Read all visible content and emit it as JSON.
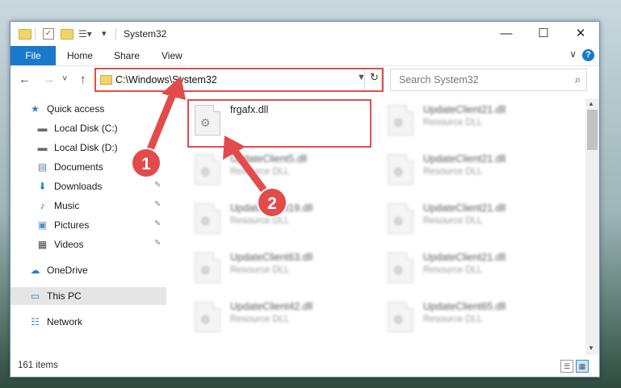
{
  "window": {
    "title": "System32",
    "controls": {
      "minimize": "—",
      "maximize": "☐",
      "close": "✕"
    }
  },
  "ribbon": {
    "tabs": [
      "File",
      "Home",
      "Share",
      "View"
    ],
    "help": "?",
    "expand": "∨"
  },
  "nav": {
    "back": "←",
    "forward": "→",
    "recent": "˅",
    "up": "↑",
    "address": "C:\\Windows\\System32",
    "search_placeholder": "Search System32"
  },
  "sidebar": {
    "items": [
      {
        "label": "Quick access",
        "icon": "star-icon",
        "glyph": "★",
        "color": "#2c7fd1"
      },
      {
        "label": "Local Disk (C:)",
        "icon": "drive-icon",
        "glyph": "▬",
        "color": "#6a6a6a"
      },
      {
        "label": "Local Disk (D:)",
        "icon": "drive-icon",
        "glyph": "▬",
        "color": "#6a6a6a"
      },
      {
        "label": "Documents",
        "icon": "document-icon",
        "glyph": "▤",
        "color": "#5b7fa8"
      },
      {
        "label": "Downloads",
        "icon": "download-icon",
        "glyph": "⬇",
        "color": "#2c7fd1"
      },
      {
        "label": "Music",
        "icon": "music-icon",
        "glyph": "♪",
        "color": "#2c7fd1"
      },
      {
        "label": "Pictures",
        "icon": "pictures-icon",
        "glyph": "▣",
        "color": "#4a90c9"
      },
      {
        "label": "Videos",
        "icon": "videos-icon",
        "glyph": "▦",
        "color": "#444"
      },
      {
        "label": "OneDrive",
        "icon": "cloud-icon",
        "glyph": "☁",
        "color": "#2c7fd1"
      },
      {
        "label": "This PC",
        "icon": "computer-icon",
        "glyph": "▭",
        "color": "#2c7fd1"
      },
      {
        "label": "Network",
        "icon": "network-icon",
        "glyph": "☷",
        "color": "#2c7fd1"
      }
    ],
    "pin": "📌"
  },
  "files": [
    {
      "name": "frgafx.dll",
      "type": ""
    },
    {
      "name": "UpdateClient21.dll",
      "type": "Resource DLL"
    },
    {
      "name": "UpdateClient5.dll",
      "type": "Resource DLL"
    },
    {
      "name": "UpdateClient21.dll",
      "type": "Resource DLL"
    },
    {
      "name": "UpdateClient19.dll",
      "type": "Resource DLL"
    },
    {
      "name": "UpdateClient21.dll",
      "type": "Resource DLL"
    },
    {
      "name": "UpdateClient63.dll",
      "type": "Resource DLL"
    },
    {
      "name": "UpdateClient21.dll",
      "type": "Resource DLL"
    },
    {
      "name": "UpdateClient42.dll",
      "type": "Resource DLL"
    },
    {
      "name": "UpdateClient65.dll",
      "type": "Resource DLL"
    }
  ],
  "status": {
    "count": "161 items"
  },
  "annotations": {
    "badge1": "1",
    "badge2": "2",
    "color": "#e34b4b"
  }
}
